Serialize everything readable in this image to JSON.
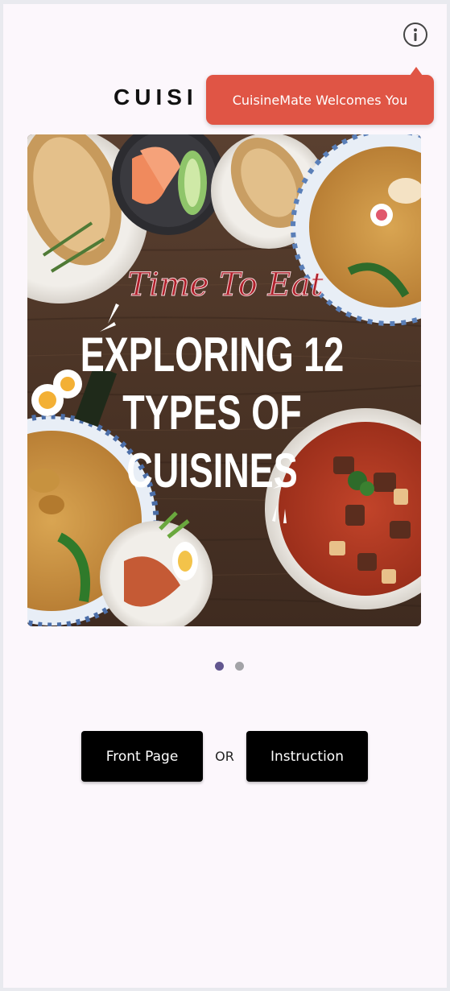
{
  "header": {
    "title": "CUISI",
    "info_icon": "info-circle-icon"
  },
  "tooltip": {
    "text": "CuisineMate Welcomes You",
    "color": "#e05545"
  },
  "banner": {
    "script_line": "Time To Eat",
    "headline_line1": "EXPLORING 12",
    "headline_line2": "TYPES OF",
    "headline_line3": "CUISINES"
  },
  "carousel": {
    "total_pages": 2,
    "active_page": 1,
    "active_color": "#62568f",
    "inactive_color": "#a3a3a7"
  },
  "actions": {
    "front_page_label": "Front Page",
    "or_label": "OR",
    "instruction_label": "Instruction"
  }
}
